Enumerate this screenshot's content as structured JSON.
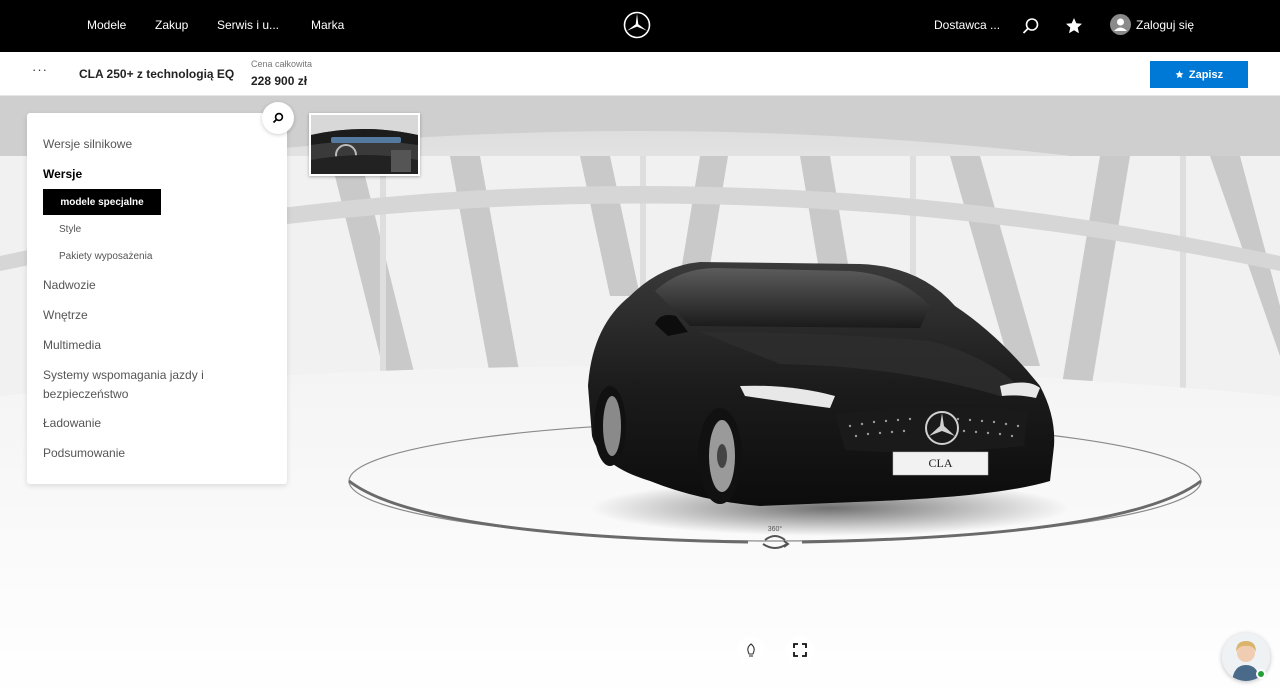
{
  "nav": {
    "links": [
      "Modele",
      "Zakup",
      "Serwis i u...",
      "Marka"
    ],
    "dealer": "Dostawca ...",
    "login": "Zaloguj się"
  },
  "header": {
    "model_name": "CLA 250+ z technologią EQ",
    "price_label": "Cena całkowita",
    "price_value": "228 900 zł",
    "save_label": "Zapisz",
    "more_icon": "more-dots-icon"
  },
  "sidebar": {
    "items": [
      "Wersje silnikowe",
      "Wersje",
      "Nadwozie",
      "Wnętrze",
      "Multimedia",
      "Systemy wspomagania jazdy i bezpieczeństwo",
      "Ładowanie",
      "Podsumowanie"
    ],
    "active_item": "Wersje",
    "sub_items": [
      "modele specjalne",
      "Style",
      "Pakiety wyposażenia"
    ],
    "selected_sub": "modele specjalne"
  },
  "stage": {
    "plate_text": "CLA",
    "rotate_label": "360°"
  },
  "colors": {
    "accent": "#0078d6",
    "nav_bg": "#000000",
    "online": "#21a038"
  }
}
